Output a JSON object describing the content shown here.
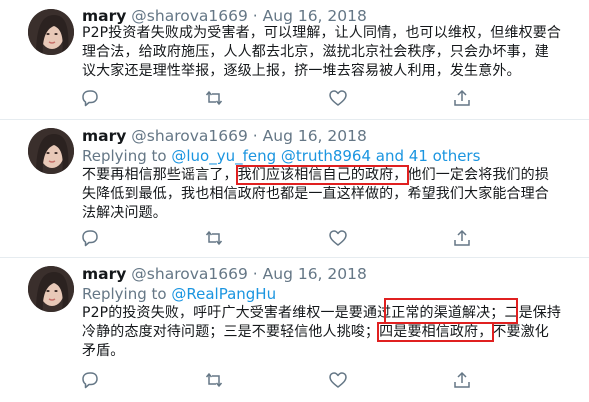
{
  "tweets": [
    {
      "display_name": "mary",
      "handle": "@sharova1669",
      "separator": "·",
      "date": "Aug 16, 2018",
      "replying_to": null,
      "body_lines": [
        "P2P投资者失败成为受害者，可以理解，让人同情，也可以维权，但维权要合",
        "理合法，给政府施压，人人都去北京，滋扰北京社会秩序，只会办坏事，建",
        "议大家还是理性举报，逐级上报，挤一堆去容易被人利用，发生意外。"
      ]
    },
    {
      "display_name": "mary",
      "handle": "@sharova1669",
      "separator": "·",
      "date": "Aug 16, 2018",
      "replying_prefix": "Replying to",
      "replying_mentions": "@luo_yu_feng @truth8964 and 41 others",
      "body_line1_a": "不要再相信那些谣言了，",
      "body_line1_hl": "我们应该相信自己的政府，",
      "body_line1_b": "他们一定会将我们的损",
      "body_line2": "失降低到最低，我也相信政府也都是一直这样做的，希望我们大家能合理合",
      "body_line3": "法解决问题。"
    },
    {
      "display_name": "mary",
      "handle": "@sharova1669",
      "separator": "·",
      "date": "Aug 16, 2018",
      "replying_prefix": "Replying to",
      "replying_mentions": "@RealPangHu",
      "body_line1": "P2P的投资失败，呼吁广大受害者维权一是要通过正常的渠道解决；二是保持",
      "body_line2_a": "冷静的态度对待问题；三是不要轻信他人挑唆；",
      "body_line2_hl": "四是要相信政府，",
      "body_line2_b": "不要激化",
      "body_line3": "矛盾。"
    }
  ],
  "icons": {
    "reply": "reply-icon",
    "retweet": "retweet-icon",
    "like": "like-icon",
    "share": "share-icon"
  },
  "colors": {
    "text": "#14171a",
    "secondary": "#657786",
    "link": "#1b95e0",
    "divider": "#e6ecf0",
    "highlight": "#e02020"
  }
}
